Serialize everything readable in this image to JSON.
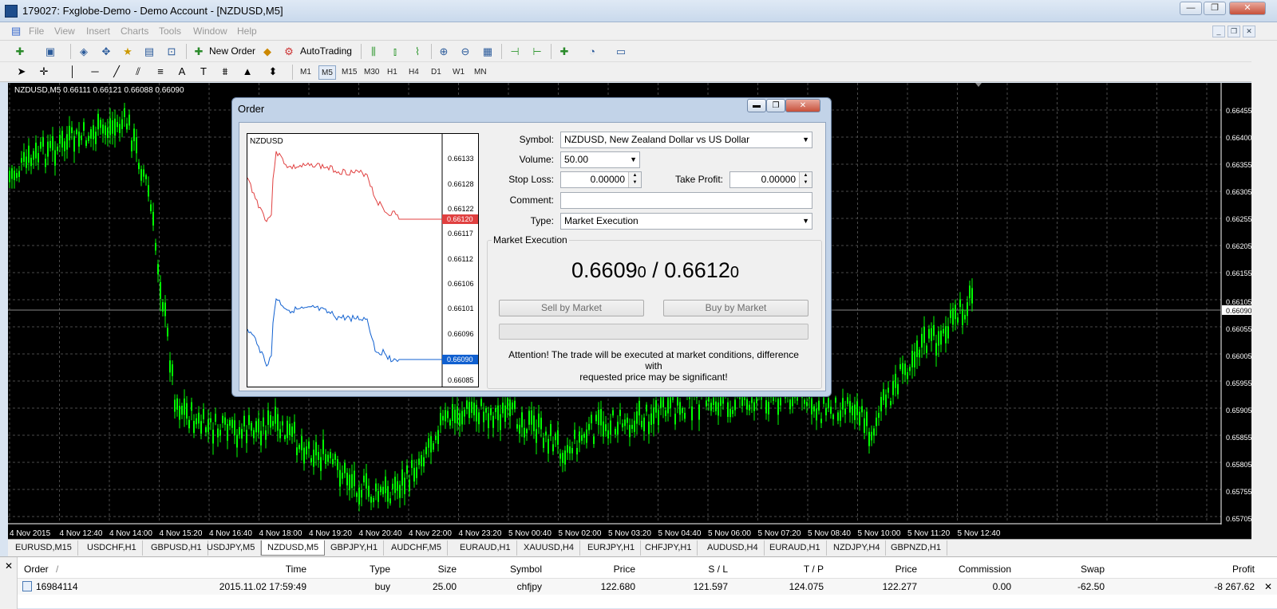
{
  "window": {
    "title": "179027: Fxglobe-Demo - Demo Account - [NZDUSD,M5]"
  },
  "menu": [
    "File",
    "View",
    "Insert",
    "Charts",
    "Tools",
    "Window",
    "Help"
  ],
  "toolbar": {
    "new_order": "New Order",
    "autotrading": "AutoTrading"
  },
  "timeframes": [
    "M1",
    "M5",
    "M15",
    "M30",
    "H1",
    "H4",
    "D1",
    "W1",
    "MN"
  ],
  "active_timeframe": "M5",
  "chart": {
    "header": "NZDUSD,M5  0.66111 0.66121 0.66088 0.66090",
    "price_labels": [
      "0.66455",
      "0.66400",
      "0.66355",
      "0.66305",
      "0.66255",
      "0.66205",
      "0.66155",
      "0.66105",
      "0.66090",
      "0.66055",
      "0.66005",
      "0.65955",
      "0.65905",
      "0.65855",
      "0.65805",
      "0.65755",
      "0.65705"
    ],
    "time_labels": [
      "4 Nov 2015",
      "4 Nov 12:40",
      "4 Nov 14:00",
      "4 Nov 15:20",
      "4 Nov 16:40",
      "4 Nov 18:00",
      "4 Nov 19:20",
      "4 Nov 20:40",
      "4 Nov 22:00",
      "4 Nov 23:20",
      "5 Nov 00:40",
      "5 Nov 02:00",
      "5 Nov 03:20",
      "5 Nov 04:40",
      "5 Nov 06:00",
      "5 Nov 07:20",
      "5 Nov 08:40",
      "5 Nov 10:00",
      "5 Nov 11:20",
      "5 Nov 12:40"
    ],
    "candle_color": "#00ff00",
    "background": "#000000"
  },
  "chart_tabs": [
    "EURUSD,M15",
    "USDCHF,H1",
    "GBPUSD,H1",
    "USDJPY,M5",
    "NZDUSD,M5",
    "GBPJPY,H1",
    "AUDCHF,M5",
    "EURAUD,H1",
    "XAUUSD,H4",
    "EURJPY,H1",
    "CHFJPY,H1",
    "AUDUSD,H4",
    "EURAUD,H1",
    "NZDJPY,H4",
    "GBPNZD,H1"
  ],
  "active_tab": "NZDUSD,M5",
  "dialog": {
    "title": "Order",
    "mini_chart": {
      "symbol": "NZDUSD",
      "price_labels": [
        "0.66133",
        "0.66128",
        "0.66122",
        "0.66117",
        "0.66112",
        "0.66106",
        "0.66101",
        "0.66096",
        "0.66085"
      ],
      "ask_tag": "0.66120",
      "bid_tag": "0.66090",
      "ask_color": "#e04040",
      "bid_color": "#1060d0"
    },
    "symbol_label": "Symbol:",
    "symbol_value": "NZDUSD, New Zealand Dollar vs US Dollar",
    "volume_label": "Volume:",
    "volume_value": "50.00",
    "stoploss_label": "Stop Loss:",
    "stoploss_value": "0.00000",
    "takeprofit_label": "Take Profit:",
    "takeprofit_value": "0.00000",
    "comment_label": "Comment:",
    "comment_value": "",
    "type_label": "Type:",
    "type_value": "Market Execution",
    "group_label": "Market Execution",
    "bid_main": "0.6609",
    "bid_small": "0",
    "separator": " / ",
    "ask_main": "0.6612",
    "ask_small": "0",
    "sell_button": "Sell by Market",
    "buy_button": "Buy by Market",
    "attention_line1": "Attention! The trade will be executed at market conditions, difference with",
    "attention_line2": "requested price may be significant!"
  },
  "terminal": {
    "headers": [
      "Order",
      "Time",
      "Type",
      "Size",
      "Symbol",
      "Price",
      "S / L",
      "T / P",
      "Price",
      "Commission",
      "Swap",
      "Profit"
    ],
    "sort_indicator": "/",
    "row": [
      "16984114",
      "2015.11.02 17:59:49",
      "buy",
      "25.00",
      "chfjpy",
      "122.680",
      "121.597",
      "124.075",
      "122.277",
      "0.00",
      "-62.50",
      "-8 267.62"
    ]
  }
}
